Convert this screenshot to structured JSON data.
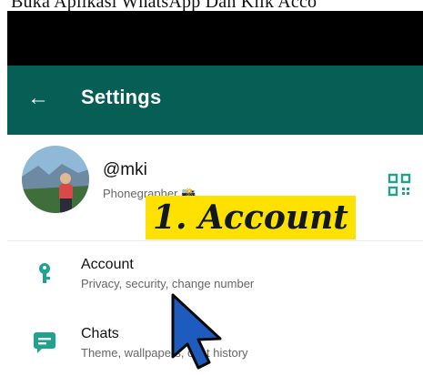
{
  "caption": "Buka Aplikasi WhatsApp Dan Klik Acco",
  "header": {
    "back_icon": "arrow-left-icon",
    "title": "Settings"
  },
  "profile": {
    "name": "@mki",
    "about": "Phonegrapher 📸",
    "qr_icon": "qr-code-icon"
  },
  "overlay_label": "1. Account",
  "settings": [
    {
      "icon": "key-icon",
      "title": "Account",
      "subtitle": "Privacy, security, change number"
    },
    {
      "icon": "chat-icon",
      "title": "Chats",
      "subtitle": "Theme, wallpapers, chat history"
    }
  ],
  "colors": {
    "header": "#075e54",
    "icon_teal": "#1fa38e",
    "overlay": "#ffe100",
    "cursor": "#1e5bbf"
  }
}
